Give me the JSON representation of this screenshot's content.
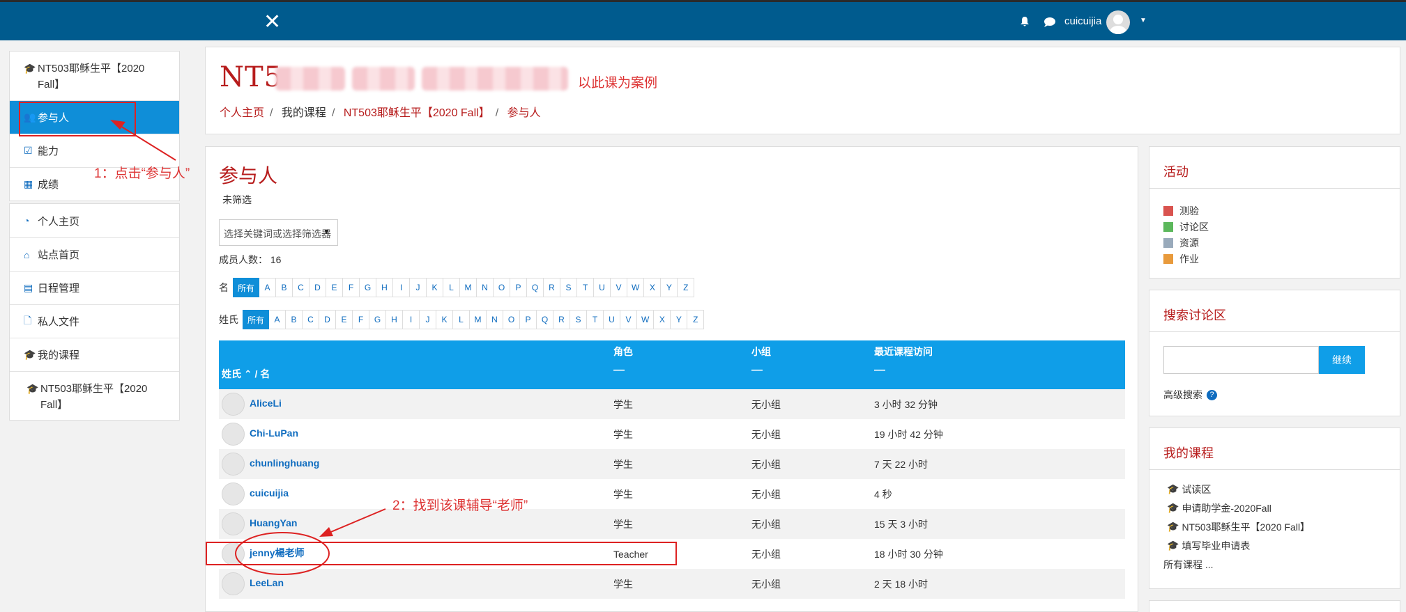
{
  "topbar": {
    "close_glyph": "✕",
    "username": "cuicuijia"
  },
  "nav_course": [
    {
      "label": "NT503耶稣生平【2020 Fall】",
      "icon": "graduation-cap-icon"
    },
    {
      "label": "参与人",
      "icon": "users-icon",
      "active": true
    },
    {
      "label": "能力",
      "icon": "checkbox-icon"
    },
    {
      "label": "成绩",
      "icon": "table-icon"
    }
  ],
  "nav_general": [
    {
      "label": "个人主页",
      "icon": "dashboard-icon"
    },
    {
      "label": "站点首页",
      "icon": "home-icon"
    },
    {
      "label": "日程管理",
      "icon": "calendar-icon"
    },
    {
      "label": "私人文件",
      "icon": "file-icon"
    },
    {
      "label": "我的课程",
      "icon": "graduation-cap-icon"
    },
    {
      "label": "NT503耶稣生平【2020 Fall】",
      "icon": "graduation-cap-icon"
    }
  ],
  "header": {
    "course_title_visible": "NT5",
    "annotation": "以此课为案例",
    "breadcrumb": [
      "个人主页",
      "我的课程",
      "NT503耶稣生平【2020 Fall】",
      "参与人"
    ]
  },
  "participants": {
    "title": "参与人",
    "no_filter": "未筛选",
    "filter_placeholder": "选择关键词或选择筛选器",
    "member_count_label": "成员人数：",
    "member_count": "16",
    "first_name_label": "名",
    "last_name_label": "姓氏",
    "all_label": "所有",
    "letters": [
      "A",
      "B",
      "C",
      "D",
      "E",
      "F",
      "G",
      "H",
      "I",
      "J",
      "K",
      "L",
      "M",
      "N",
      "O",
      "P",
      "Q",
      "R",
      "S",
      "T",
      "U",
      "V",
      "W",
      "X",
      "Y",
      "Z"
    ],
    "columns": {
      "name": "姓氏 ⌃ / 名",
      "role": "角色",
      "group": "小组",
      "last_access": "最近课程访问",
      "dash": "—"
    },
    "rows": [
      {
        "name": "AliceLi",
        "role": "学生",
        "group": "无小组",
        "last_access": "3 小时 32 分钟"
      },
      {
        "name": "Chi-LuPan",
        "role": "学生",
        "group": "无小组",
        "last_access": "19 小时 42 分钟"
      },
      {
        "name": "chunlinghuang",
        "role": "学生",
        "group": "无小组",
        "last_access": "7 天 22 小时"
      },
      {
        "name": "cuicuijia",
        "role": "学生",
        "group": "无小组",
        "last_access": "4 秒"
      },
      {
        "name": "HuangYan",
        "role": "学生",
        "group": "无小组",
        "last_access": "15 天 3 小时"
      },
      {
        "name": "jenny楊老师",
        "role": "Teacher",
        "group": "无小组",
        "last_access": "18 小时 30 分钟"
      },
      {
        "name": "LeeLan",
        "role": "学生",
        "group": "无小组",
        "last_access": "2 天 18 小时"
      }
    ]
  },
  "activities": {
    "title": "活动",
    "items": [
      {
        "label": "测验",
        "icon": "quiz-icon",
        "color": "#d9534f"
      },
      {
        "label": "讨论区",
        "icon": "forum-icon",
        "color": "#5cb85c"
      },
      {
        "label": "资源",
        "icon": "resource-icon",
        "color": "#9ab"
      },
      {
        "label": "作业",
        "icon": "assignment-icon",
        "color": "#e89a3c"
      }
    ]
  },
  "search_forum": {
    "title": "搜索讨论区",
    "button": "继续",
    "advanced": "高级搜索",
    "help": "?"
  },
  "my_courses": {
    "title": "我的课程",
    "items": [
      "试读区",
      "申请助学金-2020Fall",
      "NT503耶稣生平【2020 Fall】",
      "填写毕业申请表"
    ],
    "all": "所有课程 ..."
  },
  "annotations": {
    "step1": "1：点击“参与人”",
    "step2": "2：找到该课辅导“老师”"
  }
}
